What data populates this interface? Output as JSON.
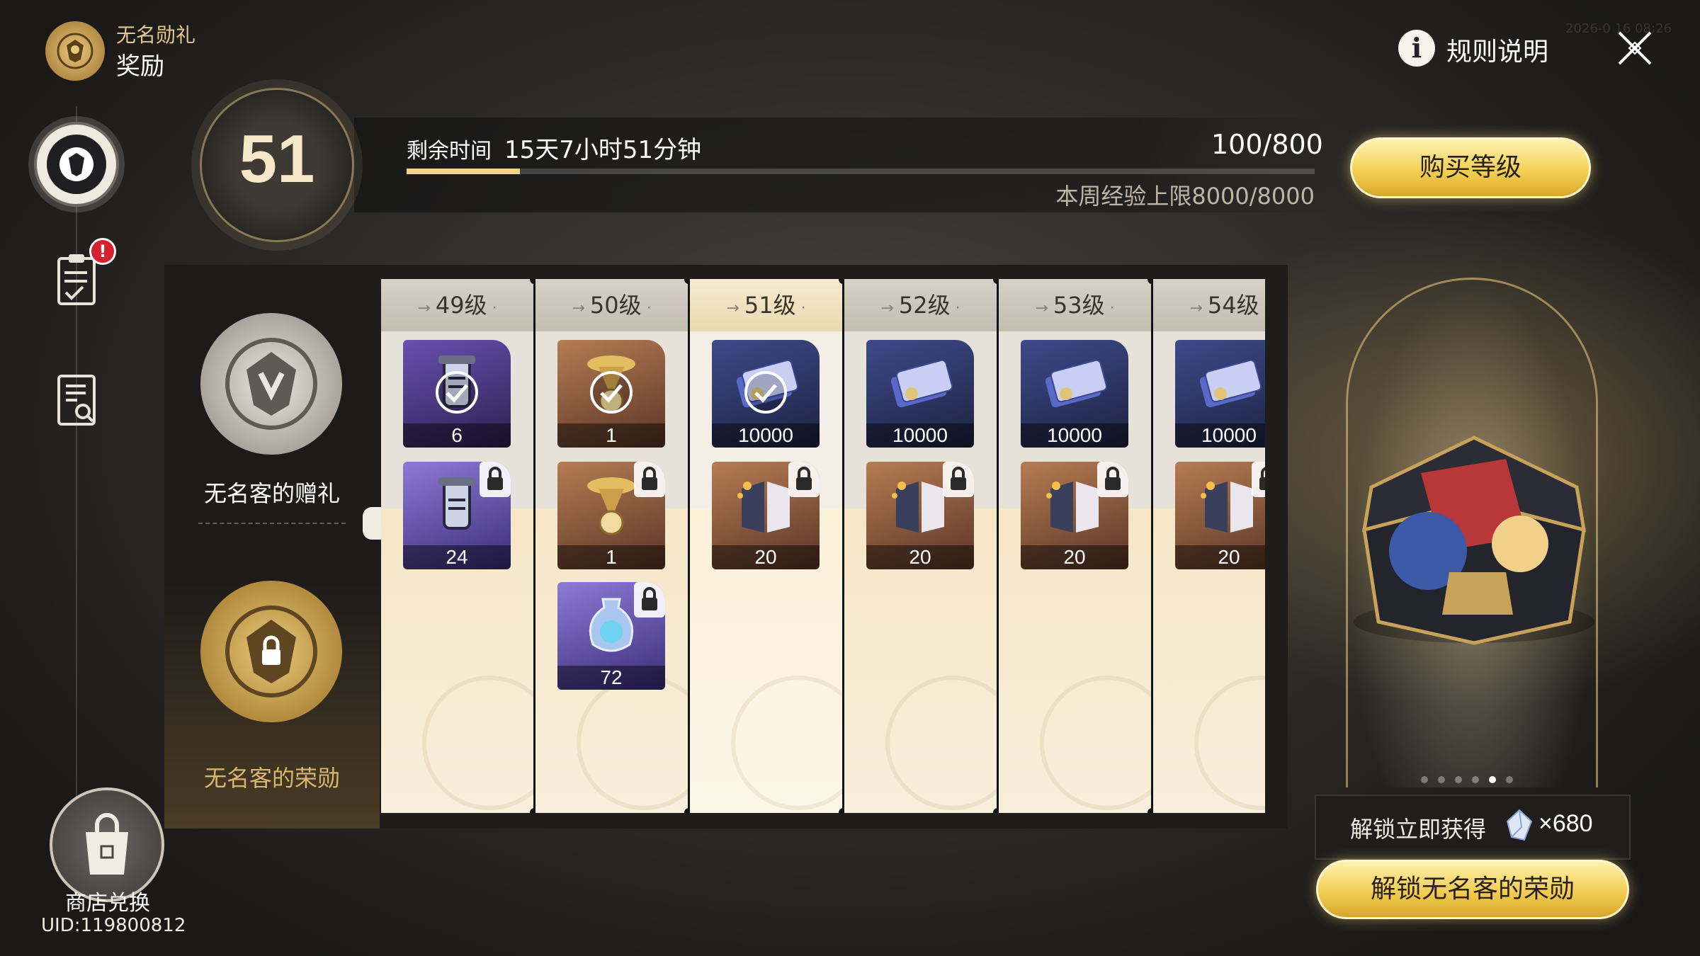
{
  "header": {
    "subtitle": "无名勋礼",
    "title": "奖励",
    "rules_label": "规则说明",
    "rules_icon": "info-icon",
    "close_icon": "close-icon",
    "timestamp": "2026-0 16 08:26"
  },
  "sidebar": {
    "items": [
      {
        "icon": "honor-emblem-icon",
        "active": true
      },
      {
        "icon": "task-clipboard-icon",
        "alert": "!"
      },
      {
        "icon": "guide-book-icon"
      }
    ],
    "shop_label": "商店兑换",
    "uid": "UID:119800812"
  },
  "level": {
    "current": "51",
    "time_label": "剩余时间",
    "time_value": "15天7小时51分钟",
    "exp": "100/800",
    "exp_progress": 0.125,
    "weekly_cap": "本周经验上限8000/8000",
    "buy_button": "购买等级"
  },
  "tracks": {
    "free_title": "无名客的赠礼",
    "premium_title": "无名客的荣勋"
  },
  "columns": [
    {
      "level": "49级",
      "current": false,
      "free": {
        "art": "relic-lantern-icon",
        "bg": "purple",
        "qty": "6",
        "claimed": true
      },
      "premium": [
        {
          "art": "relic-lantern-icon",
          "bg": "violet",
          "qty": "24",
          "locked": true
        }
      ]
    },
    {
      "level": "50级",
      "current": false,
      "free": {
        "art": "golden-trumpet-icon",
        "bg": "brown",
        "qty": "1",
        "claimed": true
      },
      "premium": [
        {
          "art": "golden-trumpet-icon",
          "bg": "brown",
          "qty": "1",
          "locked": true
        },
        {
          "art": "crystal-pouch-icon",
          "bg": "violet",
          "qty": "72",
          "locked": true
        }
      ]
    },
    {
      "level": "51级",
      "current": true,
      "free": {
        "art": "credit-card-icon",
        "bg": "navy",
        "qty": "10000",
        "claimed": true
      },
      "premium": [
        {
          "art": "book-icon",
          "bg": "brown",
          "qty": "20",
          "locked": true
        }
      ]
    },
    {
      "level": "52级",
      "current": false,
      "free": {
        "art": "credit-card-icon",
        "bg": "navy",
        "qty": "10000",
        "claimed": false
      },
      "premium": [
        {
          "art": "book-icon",
          "bg": "brown",
          "qty": "20",
          "locked": true
        }
      ]
    },
    {
      "level": "53级",
      "current": false,
      "free": {
        "art": "credit-card-icon",
        "bg": "navy",
        "qty": "10000",
        "claimed": false
      },
      "premium": [
        {
          "art": "book-icon",
          "bg": "brown",
          "qty": "20",
          "locked": true
        }
      ]
    },
    {
      "level": "54级",
      "current": false,
      "free": {
        "art": "credit-card-icon",
        "bg": "navy",
        "qty": "10000",
        "claimed": false
      },
      "premium": [
        {
          "art": "book-icon",
          "bg": "brown",
          "qty": "20",
          "locked": true
        }
      ]
    }
  ],
  "showcase": {
    "art": "treasure-chest-icon",
    "dots_count": 6,
    "active_dot": 5,
    "unlock_prefix": "解锁立即获得",
    "unlock_currency_icon": "stellar-jade-icon",
    "unlock_amount": "×680",
    "unlock_button": "解锁无名客的荣勋"
  },
  "colors": {
    "gold_button": "#f3cc4e",
    "alert_red": "#d7202e",
    "premium_text": "#d8b66c"
  }
}
